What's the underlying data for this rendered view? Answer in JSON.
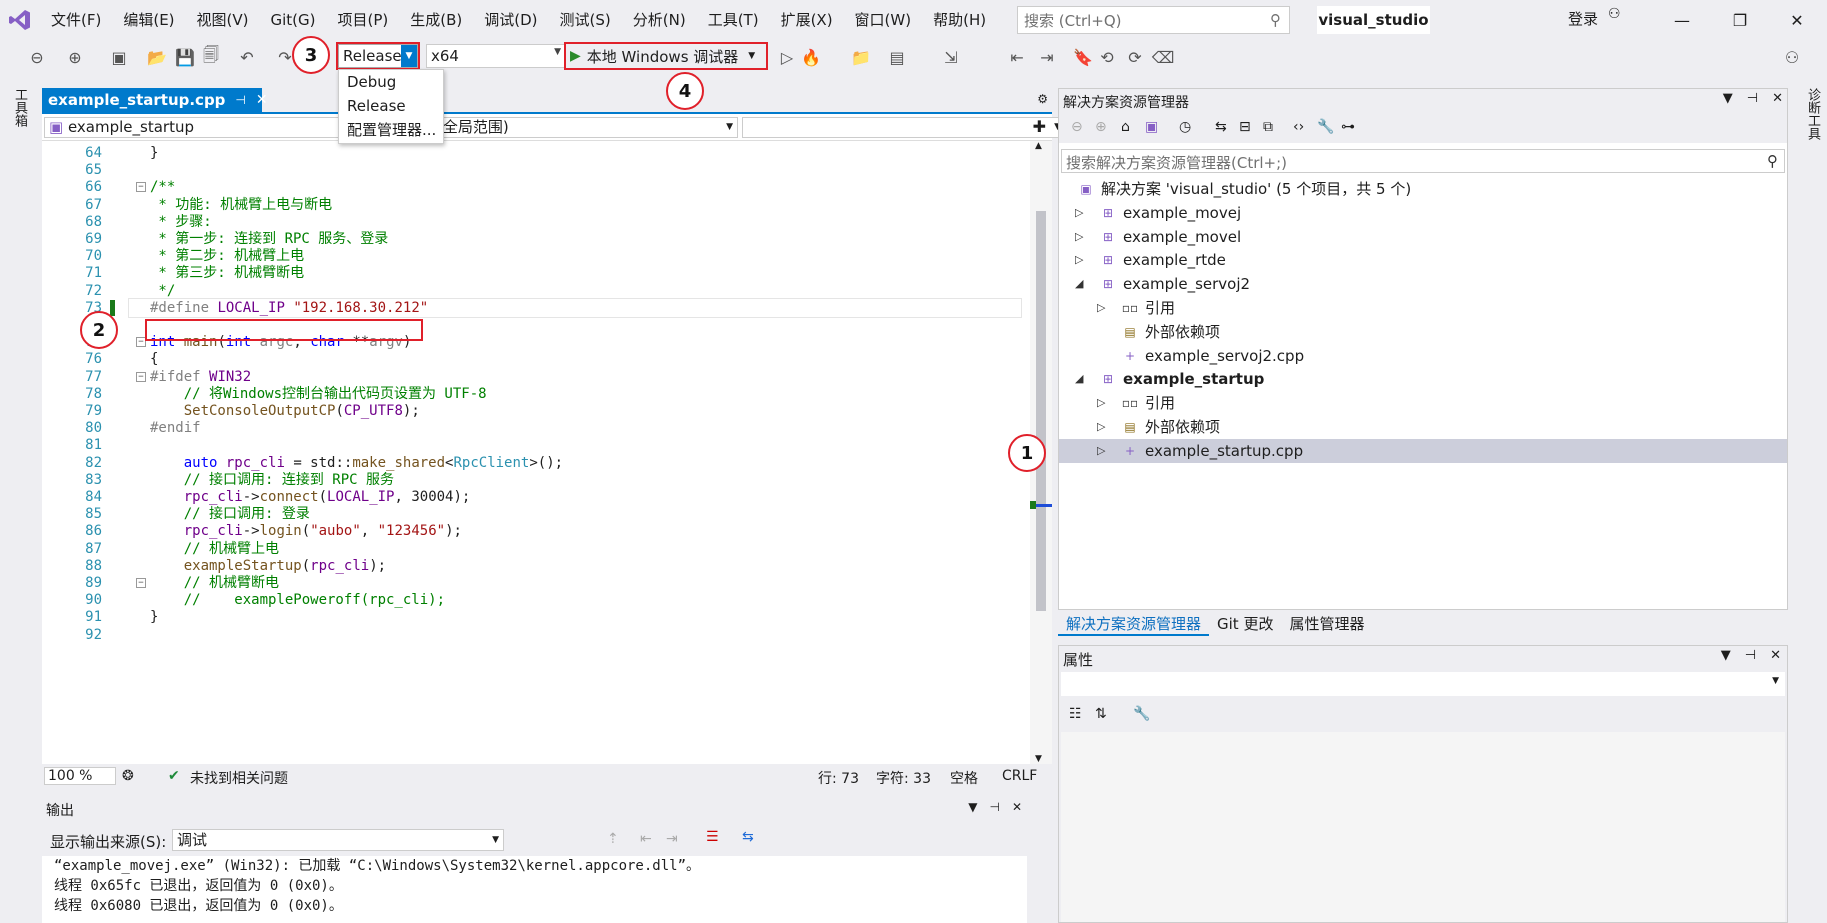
{
  "menu": [
    "文件(F)",
    "编辑(E)",
    "视图(V)",
    "Git(G)",
    "项目(P)",
    "生成(B)",
    "调试(D)",
    "测试(S)",
    "分析(N)",
    "工具(T)",
    "扩展(X)",
    "窗口(W)",
    "帮助(H)"
  ],
  "search": {
    "placeholder": "搜索 (Ctrl+Q)"
  },
  "solution_title": "visual_studio",
  "login": "登录",
  "toolbar": {
    "config": "Release",
    "platform": "x64",
    "debugger": "本地 Windows 调试器"
  },
  "config_dropdown": [
    "Debug",
    "Release",
    "配置管理器..."
  ],
  "badges": [
    "1",
    "2",
    "3",
    "4"
  ],
  "left_strip": "工具箱",
  "right_strip": "诊断工具",
  "editor": {
    "tab": "example_startup.cpp",
    "nav_scope": "example_startup",
    "nav_members": "(全局范围)",
    "lines": [
      {
        "n": "64",
        "html": "}"
      },
      {
        "n": "65",
        "html": ""
      },
      {
        "n": "66",
        "html": "<span class='c-cm'>/**</span>"
      },
      {
        "n": "67",
        "html": "<span class='c-cm'> * 功能: 机械臂上电与断电</span>"
      },
      {
        "n": "68",
        "html": "<span class='c-cm'> * 步骤:</span>"
      },
      {
        "n": "69",
        "html": "<span class='c-cm'> * 第一步: 连接到 RPC 服务、登录</span>"
      },
      {
        "n": "70",
        "html": "<span class='c-cm'> * 第二步: 机械臂上电</span>"
      },
      {
        "n": "71",
        "html": "<span class='c-cm'> * 第三步: 机械臂断电</span>"
      },
      {
        "n": "72",
        "html": "<span class='c-cm'> */</span>"
      },
      {
        "n": "73",
        "html": "<span class='c-pp'>#define</span> <span class='c-mac'>LOCAL_IP</span> <span class='c-str'>\"192.168.30.212\"</span>"
      },
      {
        "n": "74",
        "html": ""
      },
      {
        "n": "75",
        "html": "<span class='c-kw'>int</span> <span class='c-fn'>main</span>(<span class='c-kw'>int</span> <span class='c-pp'>argc</span>, <span class='c-kw'>char</span> **<span class='c-pp'>argv</span>)"
      },
      {
        "n": "76",
        "html": "{"
      },
      {
        "n": "77",
        "html": "<span class='c-pp'>#ifdef</span> <span class='c-mac'>WIN32</span>"
      },
      {
        "n": "78",
        "html": "    <span class='c-cm'>// 将Windows控制台输出代码页设置为 UTF-8</span>"
      },
      {
        "n": "79",
        "html": "    <span class='c-fn'>SetConsoleOutputCP</span>(<span class='c-mac'>CP_UTF8</span>);"
      },
      {
        "n": "80",
        "html": "<span class='c-pp'>#endif</span>"
      },
      {
        "n": "81",
        "html": ""
      },
      {
        "n": "82",
        "html": "    <span class='c-kw'>auto</span> <span class='c-mac'>rpc_cli</span> = std::<span class='c-fn'>make_shared</span>&lt;<span class='c-ty'>RpcClient</span>&gt;();"
      },
      {
        "n": "83",
        "html": "    <span class='c-cm'>// 接口调用: 连接到 RPC 服务</span>"
      },
      {
        "n": "84",
        "html": "    <span class='c-mac'>rpc_cli</span>-&gt;<span class='c-fn'>connect</span>(<span class='c-mac'>LOCAL_IP</span>, 30004);"
      },
      {
        "n": "85",
        "html": "    <span class='c-cm'>// 接口调用: 登录</span>"
      },
      {
        "n": "86",
        "html": "    <span class='c-mac'>rpc_cli</span>-&gt;<span class='c-fn'>login</span>(<span class='c-str'>\"aubo\"</span>, <span class='c-str'>\"123456\"</span>);"
      },
      {
        "n": "87",
        "html": "    <span class='c-cm'>// 机械臂上电</span>"
      },
      {
        "n": "88",
        "html": "    <span class='c-fn'>exampleStartup</span>(<span class='c-mac'>rpc_cli</span>);"
      },
      {
        "n": "89",
        "html": "    <span class='c-cm'>// 机械臂断电</span>"
      },
      {
        "n": "90",
        "html": "    <span class='c-cm'>//    examplePoweroff(rpc_cli);</span>"
      },
      {
        "n": "91",
        "html": "}"
      },
      {
        "n": "92",
        "html": ""
      }
    ],
    "zoom": "100 %",
    "issues": "未找到相关问题",
    "line_pos": "行: 73",
    "char_pos": "字符: 33",
    "ws": "空格",
    "eol": "CRLF"
  },
  "output": {
    "title": "输出",
    "source_label": "显示输出来源(S):",
    "source": "调试",
    "lines": [
      "“example_movej.exe” (Win32): 已加载 “C:\\Windows\\System32\\kernel.appcore.dll”。",
      "线程 0x65fc 已退出，返回值为 0 (0x0)。",
      "线程 0x6080 已退出，返回值为 0 (0x0)。"
    ]
  },
  "solution_explorer": {
    "title": "解决方案资源管理器",
    "search": "搜索解决方案资源管理器(Ctrl+;)",
    "tree": [
      {
        "label": "解决方案 'visual_studio' (5 个项目，共 5 个)",
        "level": 0,
        "tri": "",
        "icon": "solution-icon"
      },
      {
        "label": "example_movej",
        "level": 1,
        "tri": "▷",
        "icon": "project-icon"
      },
      {
        "label": "example_movel",
        "level": 1,
        "tri": "▷",
        "icon": "project-icon"
      },
      {
        "label": "example_rtde",
        "level": 1,
        "tri": "▷",
        "icon": "project-icon"
      },
      {
        "label": "example_servoj2",
        "level": 1,
        "tri": "◢",
        "icon": "project-icon"
      },
      {
        "label": "引用",
        "level": 2,
        "tri": "▷",
        "icon": "references-icon"
      },
      {
        "label": "外部依赖项",
        "level": 2,
        "tri": "",
        "icon": "external-deps-icon"
      },
      {
        "label": "example_servoj2.cpp",
        "level": 2,
        "tri": "",
        "icon": "cpp-file-icon"
      },
      {
        "label": "example_startup",
        "level": 1,
        "tri": "◢",
        "icon": "project-icon",
        "bold": true
      },
      {
        "label": "引用",
        "level": 2,
        "tri": "▷",
        "icon": "references-icon"
      },
      {
        "label": "外部依赖项",
        "level": 2,
        "tri": "▷",
        "icon": "external-deps-icon"
      },
      {
        "label": "example_startup.cpp",
        "level": 2,
        "tri": "▷",
        "icon": "cpp-file-icon",
        "selected": true
      }
    ],
    "tabs": [
      "解决方案资源管理器",
      "Git 更改",
      "属性管理器"
    ]
  },
  "properties": {
    "title": "属性"
  },
  "colors": {
    "accent": "#007acc",
    "highlight": "#e0202a"
  }
}
